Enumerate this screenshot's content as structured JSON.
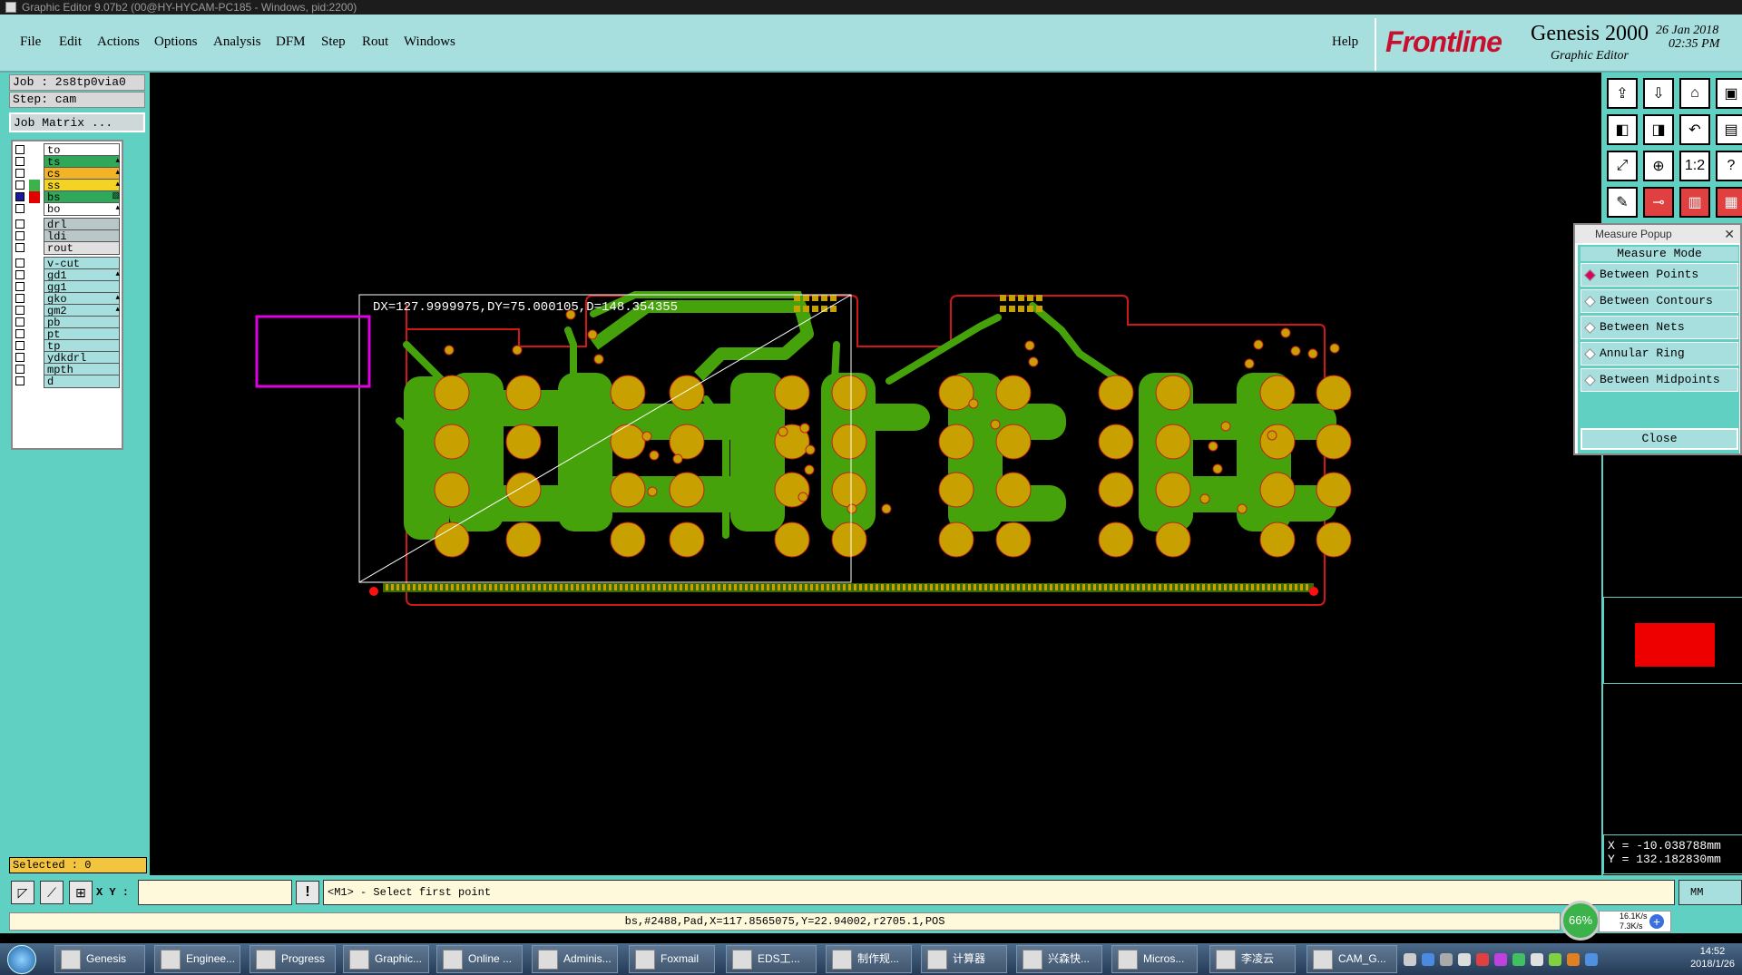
{
  "window": {
    "title": "Graphic Editor 9.07b2 (00@HY-HYCAM-PC185 - Windows, pid:2200)"
  },
  "menu": {
    "items": [
      "File",
      "Edit",
      "Actions",
      "Options",
      "Analysis",
      "DFM",
      "Step",
      "Rout",
      "Windows"
    ],
    "help": "Help"
  },
  "brand": {
    "logo": "Frontline",
    "product": "Genesis 2000",
    "subtitle": "Graphic Editor",
    "date": "26 Jan 2018",
    "time": "02:35 PM"
  },
  "job": {
    "job_label": "Job : 2s8tp0via0",
    "step_label": "Step: cam",
    "matrix_button": "Job Matrix ..."
  },
  "layers": [
    {
      "name": "to",
      "color": "#ffffff",
      "mark": ""
    },
    {
      "name": "ts",
      "color": "#2fa85a",
      "mark": "▴"
    },
    {
      "name": "cs",
      "color": "#f2b326",
      "mark": "▴"
    },
    {
      "name": "ss",
      "color": "#f2d326",
      "mark": "▴",
      "swatch": "#3cb34a"
    },
    {
      "name": "bs",
      "color": "#2fa85a",
      "mark": "▧",
      "swatch": "#e00000",
      "checked": true
    },
    {
      "name": "bo",
      "color": "#ffffff",
      "mark": "▴"
    },
    {
      "name": "drl",
      "color": "#b9c7c9",
      "mark": ""
    },
    {
      "name": "ldi",
      "color": "#b9c7c9",
      "mark": ""
    },
    {
      "name": "rout",
      "color": "#e0e0e0",
      "mark": ""
    },
    {
      "name": "v-cut",
      "color": "#a7dede",
      "mark": ""
    },
    {
      "name": "gd1",
      "color": "#a7dede",
      "mark": "▴"
    },
    {
      "name": "gg1",
      "color": "#a7dede",
      "mark": ""
    },
    {
      "name": "gko",
      "color": "#a7dede",
      "mark": "▴"
    },
    {
      "name": "gm2",
      "color": "#a7dede",
      "mark": "▴"
    },
    {
      "name": "pb",
      "color": "#a7dede",
      "mark": ""
    },
    {
      "name": "pt",
      "color": "#a7dede",
      "mark": ""
    },
    {
      "name": "tp",
      "color": "#a7dede",
      "mark": ""
    },
    {
      "name": "ydkdrl",
      "color": "#a7dede",
      "mark": ""
    },
    {
      "name": "mpth",
      "color": "#a7dede",
      "mark": ""
    },
    {
      "name": "d",
      "color": "#a7dede",
      "mark": ""
    }
  ],
  "selected": "Selected : 0",
  "measure": {
    "title": "Measure Popup",
    "mode_label": "Measure Mode",
    "options": [
      {
        "label": "Between Points",
        "selected": true
      },
      {
        "label": "Between Contours",
        "selected": false
      },
      {
        "label": "Between Nets",
        "selected": false
      },
      {
        "label": "Annular Ring",
        "selected": false
      },
      {
        "label": "Between Midpoints",
        "selected": false
      }
    ],
    "close": "Close",
    "readout": "DX=127.9999975,DY=75.000105,D=148.354355"
  },
  "coords": {
    "x": "X = -10.038788mm",
    "y": "Y = 132.182830mm"
  },
  "command": {
    "xy_label": "X Y :",
    "input_value": "",
    "prompt": "<M1> - Select first point",
    "unit_button": "MM"
  },
  "status": {
    "text": "bs,#2488,Pad,X=117.8565075,Y=22.94002,r2705.1,POS"
  },
  "network": {
    "percent": "66%",
    "up": "16.1K/s",
    "down": "7.3K/s"
  },
  "taskbar": {
    "items": [
      "Genesis",
      "Enginee...",
      "Progress",
      "Graphic...",
      "Online ...",
      "Adminis...",
      "Foxmail",
      "EDS工...",
      "制作规...",
      "计算器",
      "兴森快...",
      "Micros...",
      "李凌云",
      "CAM_G..."
    ],
    "time": "14:52",
    "date": "2018/1/26"
  },
  "colors": {
    "background": "#000000",
    "panel": "#5fd0c2",
    "trace": "#46a20a",
    "pad": "#c8a000",
    "outline": "#d01818",
    "accent": "#e000e0"
  }
}
